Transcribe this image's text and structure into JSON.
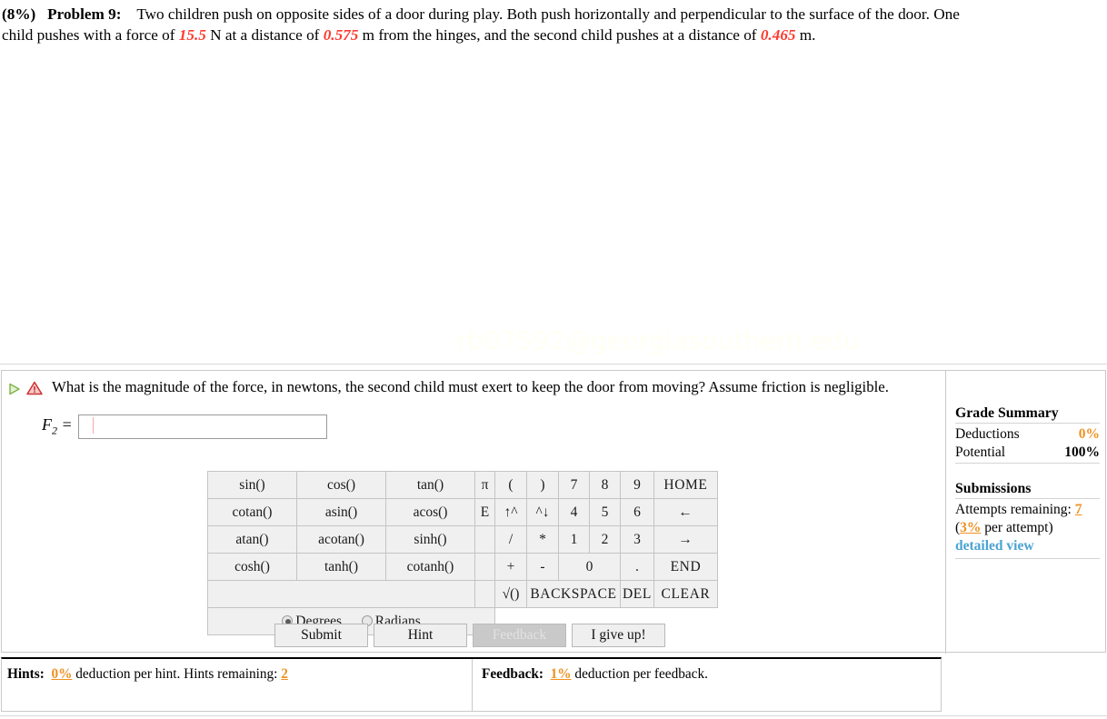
{
  "problem": {
    "percent": "(8%)",
    "label": "Problem 9:",
    "text_1": "Two children push on opposite sides of a door during play. Both push horizontally and perpendicular to the surface of the door. One child pushes with a force of ",
    "force": "15.5",
    "text_2": " N at a distance of ",
    "distance_1": "0.575",
    "text_3": " m from the hinges, and the second child pushes at a distance of ",
    "distance_2": "0.465",
    "text_4": " m."
  },
  "watermark": "rb07592@georgiasouthern.edu",
  "question": {
    "text": "What is the magnitude of the force, in newtons, the second child must exert to keep the door from moving? Assume friction is negligible.",
    "answer_label": "F2 =",
    "answer_var": "F",
    "answer_sub": "2",
    "answer_eq": "=",
    "answer_value": "",
    "answer_placeholder": ""
  },
  "keypad": {
    "rows": [
      [
        "sin()",
        "cos()",
        "tan()"
      ],
      [
        "cotan()",
        "asin()",
        "acos()"
      ],
      [
        "atan()",
        "acotan()",
        "sinh()"
      ],
      [
        "cosh()",
        "tanh()",
        "cotanh()"
      ]
    ],
    "const_keys": [
      "π",
      "E",
      "",
      "",
      ""
    ],
    "op_col_a": [
      "(",
      "↑^",
      "/",
      "+",
      "√()"
    ],
    "op_col_b": [
      ")",
      "^↓",
      "*",
      "-",
      ""
    ],
    "numbers": [
      [
        "7",
        "8",
        "9"
      ],
      [
        "4",
        "5",
        "6"
      ],
      [
        "1",
        "2",
        "3"
      ]
    ],
    "zero": "0",
    "dot": ".",
    "nav": [
      "HOME",
      "←",
      "→",
      "END",
      "CLEAR"
    ],
    "backspace": "BACKSPACE",
    "del": "DEL",
    "angle_mode": {
      "degrees": "Degrees",
      "radians": "Radians",
      "selected": "Degrees"
    }
  },
  "buttons": {
    "submit": "Submit",
    "hint": "Hint",
    "feedback": "Feedback",
    "give_up": "I give up!"
  },
  "grade_summary": {
    "title": "Grade Summary",
    "deductions_label": "Deductions",
    "deductions_value": "0%",
    "potential_label": "Potential",
    "potential_value": "100%",
    "submissions_title": "Submissions",
    "attempts_label": "Attempts remaining:",
    "attempts_value": "7",
    "per_attempt_value": "3%",
    "per_attempt_text": " per attempt)",
    "per_attempt_open": "(",
    "detailed_view": "detailed view"
  },
  "bottom": {
    "hints_label": "Hints:",
    "hints_deduction": "0%",
    "hints_text_1": " deduction per hint. Hints remaining: ",
    "hints_remaining": "2",
    "feedback_label": "Feedback:",
    "feedback_deduction": "1%",
    "feedback_text": " deduction per feedback."
  },
  "colors": {
    "accent_orange": "#ef9122",
    "value_red": "#ff3b30",
    "link_blue": "#4ba3d3",
    "warn_red": "#cc3333",
    "play_green": "#7cb342"
  }
}
